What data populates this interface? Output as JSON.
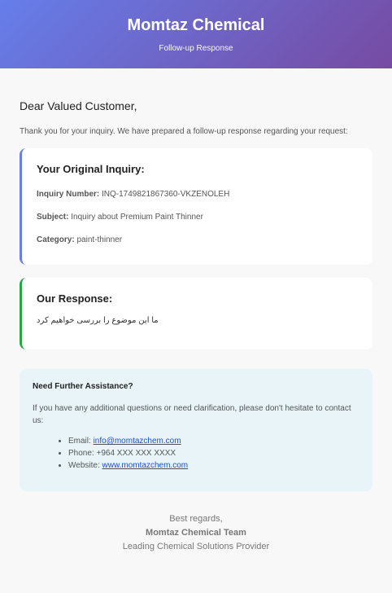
{
  "header": {
    "title": "Momtaz Chemical",
    "subtitle": "Follow-up Response"
  },
  "greeting": "Dear Valued Customer,",
  "intro": "Thank you for your inquiry. We have prepared a follow-up response regarding your request:",
  "inquiry": {
    "title": "Your Original Inquiry:",
    "number_label": "Inquiry Number:",
    "number": "INQ-1749821867360-VKZENOLEH",
    "subject_label": "Subject:",
    "subject": "Inquiry about Premium Paint Thinner",
    "category_label": "Category:",
    "category": "paint-thinner"
  },
  "response": {
    "title": "Our Response:",
    "text": "ما این موضوع را بررسی خواهیم کرد"
  },
  "help": {
    "title": "Need Further Assistance?",
    "text": "If you have any additional questions or need clarification, please don't hesitate to contact us:",
    "email_label": "Email:",
    "email": "info@momtazchem.com",
    "phone_label": "Phone:",
    "phone": "+964 XXX XXX XXXX",
    "website_label": "Website:",
    "website": "www.momtazchem.com"
  },
  "footer": {
    "regards": "Best regards,",
    "team": "Momtaz Chemical Team",
    "tagline": "Leading Chemical Solutions Provider"
  }
}
